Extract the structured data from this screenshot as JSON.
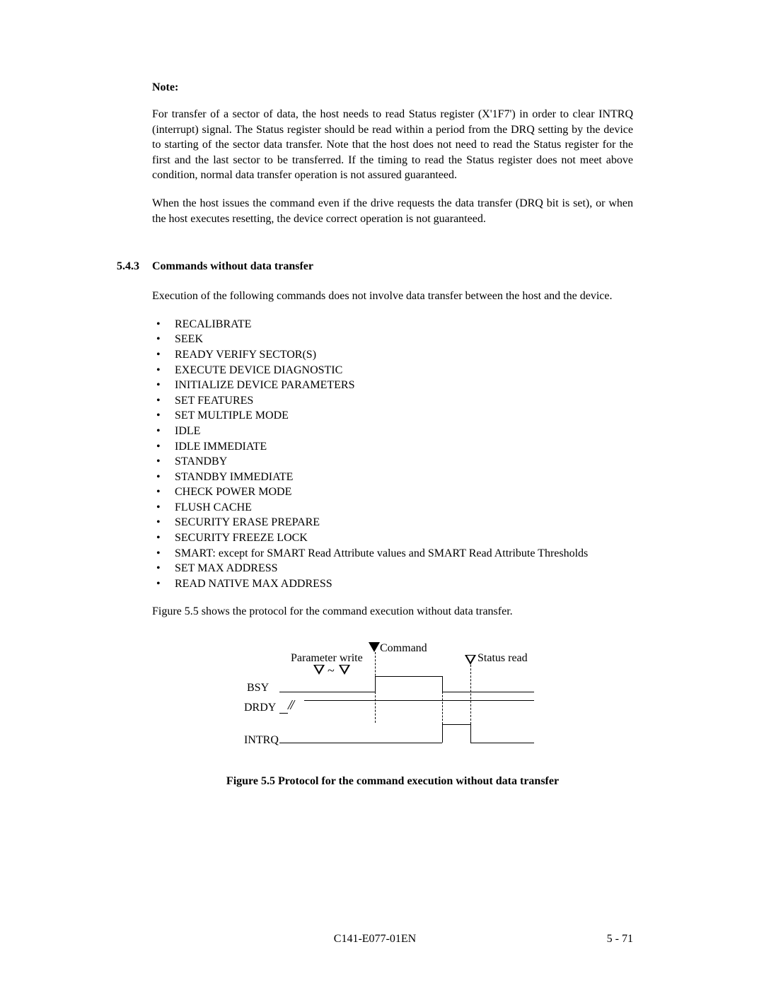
{
  "note": {
    "heading": "Note:",
    "para1": "For transfer of a sector of data, the host needs to read Status register (X'1F7') in order to clear INTRQ (interrupt) signal. The Status register should be read within a period from the DRQ setting by the device to starting of the sector data transfer.  Note that the host does not need to read the Status register for the first and the last sector to be transferred.  If the timing to read the Status register does not meet above condition, normal data transfer operation is not assured guaranteed.",
    "para2": "When the host issues the command even if the drive requests the data transfer (DRQ bit is set), or when the host executes resetting, the device correct operation is not guaranteed."
  },
  "section": {
    "number": "5.4.3",
    "title": "Commands without data transfer",
    "intro": "Execution of the following commands does not involve data transfer between the host and the device.",
    "commands": [
      "RECALIBRATE",
      "SEEK",
      "READY VERIFY SECTOR(S)",
      "EXECUTE DEVICE DIAGNOSTIC",
      "INITIALIZE DEVICE PARAMETERS",
      "SET FEATURES",
      "SET MULTIPLE MODE",
      "IDLE",
      "IDLE IMMEDIATE",
      "STANDBY",
      "STANDBY IMMEDIATE",
      "CHECK POWER MODE",
      "FLUSH CACHE",
      "SECURITY ERASE PREPARE",
      "SECURITY FREEZE LOCK",
      "SMART:  except for SMART Read Attribute values and SMART Read Attribute Thresholds",
      "SET MAX ADDRESS",
      "READ NATIVE MAX ADDRESS"
    ],
    "outro": "Figure 5.5 shows the protocol for the command execution without data transfer."
  },
  "diagram": {
    "labels": {
      "parameter_write": "Parameter write",
      "command": "Command",
      "status_read": "Status read",
      "bsy": "BSY",
      "drdy": "DRDY",
      "intrq": "INTRQ"
    },
    "tilde": "~",
    "slashes": "//"
  },
  "figure_caption": "Figure 5.5    Protocol for the command execution without data transfer",
  "footer": {
    "doc_number": "C141-E077-01EN",
    "page_number": "5 - 71"
  }
}
